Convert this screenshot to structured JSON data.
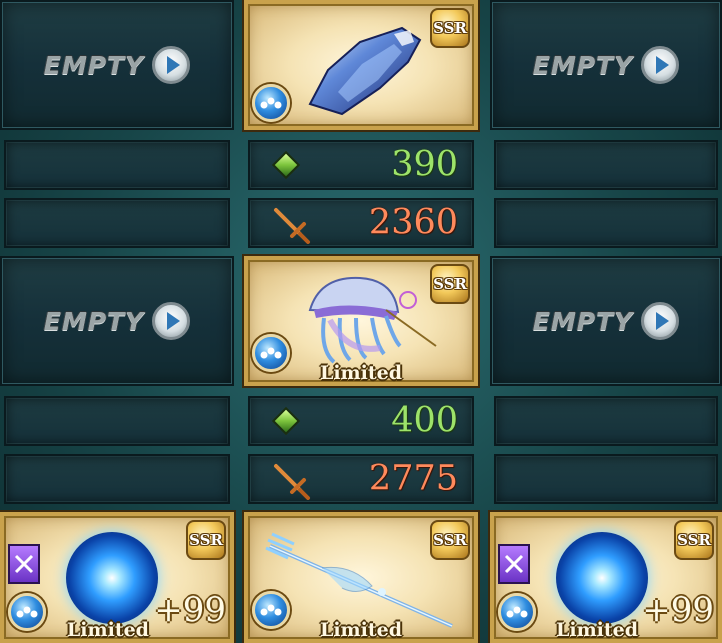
{
  "slots": {
    "empty_label": "EMPTY"
  },
  "stats": [
    {
      "hp": "390",
      "atk": "2360"
    },
    {
      "hp": "400",
      "atk": "2775"
    }
  ],
  "cards": {
    "badge": "SSR",
    "limited": "Limited",
    "plus": "+99"
  },
  "icons": {
    "hp": "green-gem-icon",
    "atk": "sword-icon",
    "element": "water-element-icon",
    "weapon_class": "crossed-swords-icon"
  },
  "colors": {
    "hp": "#9de36a",
    "atk": "#ff8a5c",
    "water": "#2f8de0",
    "gold_frame": "#c9a24c"
  }
}
